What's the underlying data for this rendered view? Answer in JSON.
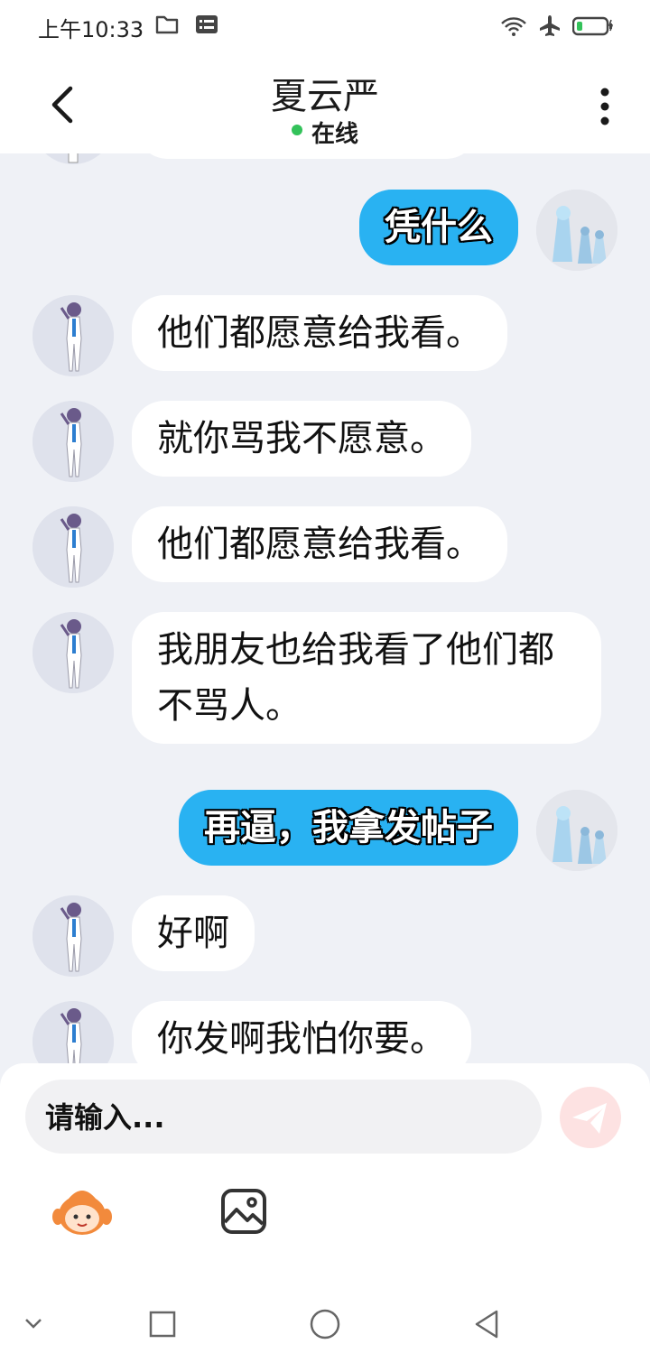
{
  "status_bar": {
    "time": "上午10:33",
    "icons": [
      "folder-icon",
      "storage-icon",
      "wifi-icon",
      "airplane-mode-icon",
      "battery-icon"
    ],
    "battery_color": "#33c25a"
  },
  "header": {
    "title": "夏云严",
    "status": "在线",
    "status_color": "#33c25a"
  },
  "colors": {
    "outgoing_bubble": "#29b2f2",
    "incoming_bubble": "#ffffff",
    "chat_background": "#eff1f6"
  },
  "messages": [
    {
      "sender": "me",
      "text": "凭什么"
    },
    {
      "sender": "other",
      "text": "他们都愿意给我看。"
    },
    {
      "sender": "other",
      "text": "就你骂我不愿意。"
    },
    {
      "sender": "other",
      "text": "他们都愿意给我看。"
    },
    {
      "sender": "other",
      "text": "我朋友也给我看了他们都不骂人。"
    },
    {
      "sender": "me",
      "text": "再逼，我拿发帖子"
    },
    {
      "sender": "other",
      "text": "好啊"
    },
    {
      "sender": "other",
      "text": "你发啊我怕你要。"
    }
  ],
  "composer": {
    "placeholder": "请输入...",
    "send_icon": "paper-plane-icon",
    "tools": [
      "emoji-mascot-icon",
      "image-icon"
    ]
  },
  "nav_bar": {
    "buttons": [
      "collapse-chevron-icon",
      "recents-square-icon",
      "home-circle-icon",
      "back-triangle-icon"
    ]
  }
}
